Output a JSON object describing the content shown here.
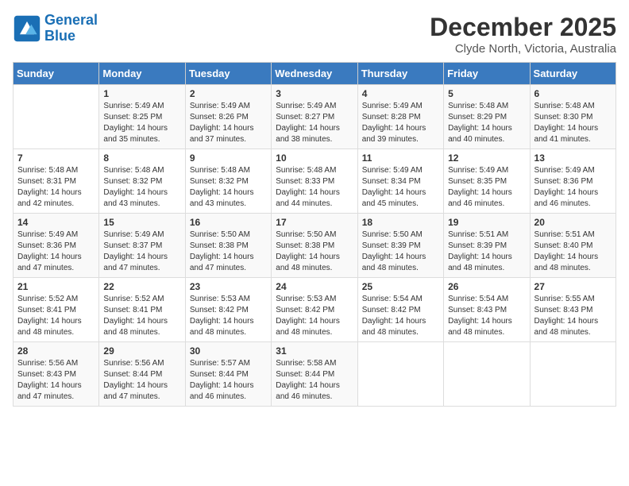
{
  "header": {
    "logo_line1": "General",
    "logo_line2": "Blue",
    "month_title": "December 2025",
    "subtitle": "Clyde North, Victoria, Australia"
  },
  "days_of_week": [
    "Sunday",
    "Monday",
    "Tuesday",
    "Wednesday",
    "Thursday",
    "Friday",
    "Saturday"
  ],
  "weeks": [
    [
      {
        "day": "",
        "sunrise": "",
        "sunset": "",
        "daylight": ""
      },
      {
        "day": "1",
        "sunrise": "Sunrise: 5:49 AM",
        "sunset": "Sunset: 8:25 PM",
        "daylight": "Daylight: 14 hours and 35 minutes."
      },
      {
        "day": "2",
        "sunrise": "Sunrise: 5:49 AM",
        "sunset": "Sunset: 8:26 PM",
        "daylight": "Daylight: 14 hours and 37 minutes."
      },
      {
        "day": "3",
        "sunrise": "Sunrise: 5:49 AM",
        "sunset": "Sunset: 8:27 PM",
        "daylight": "Daylight: 14 hours and 38 minutes."
      },
      {
        "day": "4",
        "sunrise": "Sunrise: 5:49 AM",
        "sunset": "Sunset: 8:28 PM",
        "daylight": "Daylight: 14 hours and 39 minutes."
      },
      {
        "day": "5",
        "sunrise": "Sunrise: 5:48 AM",
        "sunset": "Sunset: 8:29 PM",
        "daylight": "Daylight: 14 hours and 40 minutes."
      },
      {
        "day": "6",
        "sunrise": "Sunrise: 5:48 AM",
        "sunset": "Sunset: 8:30 PM",
        "daylight": "Daylight: 14 hours and 41 minutes."
      }
    ],
    [
      {
        "day": "7",
        "sunrise": "Sunrise: 5:48 AM",
        "sunset": "Sunset: 8:31 PM",
        "daylight": "Daylight: 14 hours and 42 minutes."
      },
      {
        "day": "8",
        "sunrise": "Sunrise: 5:48 AM",
        "sunset": "Sunset: 8:32 PM",
        "daylight": "Daylight: 14 hours and 43 minutes."
      },
      {
        "day": "9",
        "sunrise": "Sunrise: 5:48 AM",
        "sunset": "Sunset: 8:32 PM",
        "daylight": "Daylight: 14 hours and 43 minutes."
      },
      {
        "day": "10",
        "sunrise": "Sunrise: 5:48 AM",
        "sunset": "Sunset: 8:33 PM",
        "daylight": "Daylight: 14 hours and 44 minutes."
      },
      {
        "day": "11",
        "sunrise": "Sunrise: 5:49 AM",
        "sunset": "Sunset: 8:34 PM",
        "daylight": "Daylight: 14 hours and 45 minutes."
      },
      {
        "day": "12",
        "sunrise": "Sunrise: 5:49 AM",
        "sunset": "Sunset: 8:35 PM",
        "daylight": "Daylight: 14 hours and 46 minutes."
      },
      {
        "day": "13",
        "sunrise": "Sunrise: 5:49 AM",
        "sunset": "Sunset: 8:36 PM",
        "daylight": "Daylight: 14 hours and 46 minutes."
      }
    ],
    [
      {
        "day": "14",
        "sunrise": "Sunrise: 5:49 AM",
        "sunset": "Sunset: 8:36 PM",
        "daylight": "Daylight: 14 hours and 47 minutes."
      },
      {
        "day": "15",
        "sunrise": "Sunrise: 5:49 AM",
        "sunset": "Sunset: 8:37 PM",
        "daylight": "Daylight: 14 hours and 47 minutes."
      },
      {
        "day": "16",
        "sunrise": "Sunrise: 5:50 AM",
        "sunset": "Sunset: 8:38 PM",
        "daylight": "Daylight: 14 hours and 47 minutes."
      },
      {
        "day": "17",
        "sunrise": "Sunrise: 5:50 AM",
        "sunset": "Sunset: 8:38 PM",
        "daylight": "Daylight: 14 hours and 48 minutes."
      },
      {
        "day": "18",
        "sunrise": "Sunrise: 5:50 AM",
        "sunset": "Sunset: 8:39 PM",
        "daylight": "Daylight: 14 hours and 48 minutes."
      },
      {
        "day": "19",
        "sunrise": "Sunrise: 5:51 AM",
        "sunset": "Sunset: 8:39 PM",
        "daylight": "Daylight: 14 hours and 48 minutes."
      },
      {
        "day": "20",
        "sunrise": "Sunrise: 5:51 AM",
        "sunset": "Sunset: 8:40 PM",
        "daylight": "Daylight: 14 hours and 48 minutes."
      }
    ],
    [
      {
        "day": "21",
        "sunrise": "Sunrise: 5:52 AM",
        "sunset": "Sunset: 8:41 PM",
        "daylight": "Daylight: 14 hours and 48 minutes."
      },
      {
        "day": "22",
        "sunrise": "Sunrise: 5:52 AM",
        "sunset": "Sunset: 8:41 PM",
        "daylight": "Daylight: 14 hours and 48 minutes."
      },
      {
        "day": "23",
        "sunrise": "Sunrise: 5:53 AM",
        "sunset": "Sunset: 8:42 PM",
        "daylight": "Daylight: 14 hours and 48 minutes."
      },
      {
        "day": "24",
        "sunrise": "Sunrise: 5:53 AM",
        "sunset": "Sunset: 8:42 PM",
        "daylight": "Daylight: 14 hours and 48 minutes."
      },
      {
        "day": "25",
        "sunrise": "Sunrise: 5:54 AM",
        "sunset": "Sunset: 8:42 PM",
        "daylight": "Daylight: 14 hours and 48 minutes."
      },
      {
        "day": "26",
        "sunrise": "Sunrise: 5:54 AM",
        "sunset": "Sunset: 8:43 PM",
        "daylight": "Daylight: 14 hours and 48 minutes."
      },
      {
        "day": "27",
        "sunrise": "Sunrise: 5:55 AM",
        "sunset": "Sunset: 8:43 PM",
        "daylight": "Daylight: 14 hours and 48 minutes."
      }
    ],
    [
      {
        "day": "28",
        "sunrise": "Sunrise: 5:56 AM",
        "sunset": "Sunset: 8:43 PM",
        "daylight": "Daylight: 14 hours and 47 minutes."
      },
      {
        "day": "29",
        "sunrise": "Sunrise: 5:56 AM",
        "sunset": "Sunset: 8:44 PM",
        "daylight": "Daylight: 14 hours and 47 minutes."
      },
      {
        "day": "30",
        "sunrise": "Sunrise: 5:57 AM",
        "sunset": "Sunset: 8:44 PM",
        "daylight": "Daylight: 14 hours and 46 minutes."
      },
      {
        "day": "31",
        "sunrise": "Sunrise: 5:58 AM",
        "sunset": "Sunset: 8:44 PM",
        "daylight": "Daylight: 14 hours and 46 minutes."
      },
      {
        "day": "",
        "sunrise": "",
        "sunset": "",
        "daylight": ""
      },
      {
        "day": "",
        "sunrise": "",
        "sunset": "",
        "daylight": ""
      },
      {
        "day": "",
        "sunrise": "",
        "sunset": "",
        "daylight": ""
      }
    ]
  ]
}
